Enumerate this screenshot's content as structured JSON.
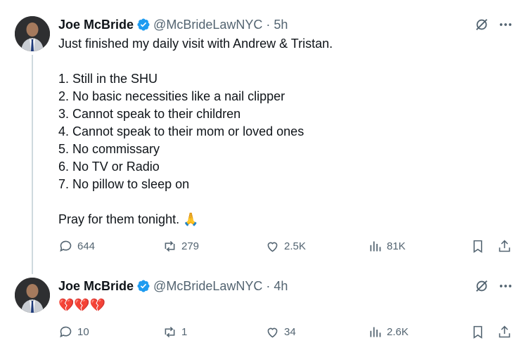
{
  "colors": {
    "verified": "#1d9bf0",
    "secondary_text": "#536471",
    "primary_text": "#0f1419",
    "thread_line": "#cfd9de",
    "heart": "#dd2e44"
  },
  "tweets": [
    {
      "name": "Joe McBride",
      "handle": "@McBrideLawNYC",
      "separator": "·",
      "time": "5h",
      "lines": [
        "Just finished my daily visit with Andrew & Tristan.",
        "",
        "1. Still in the SHU",
        "2. No basic necessities like a nail clipper",
        "3. Cannot speak to their children",
        "4. Cannot speak to their mom or loved ones",
        "5. No commissary",
        "6. No TV or Radio",
        "7. No pillow to sleep on",
        "",
        "Pray for them tonight. 🙏"
      ],
      "replies": "644",
      "reposts": "279",
      "likes": "2.5K",
      "views": "81K"
    },
    {
      "name": "Joe McBride",
      "handle": "@McBrideLawNYC",
      "separator": "·",
      "time": "4h",
      "lines": [
        "💔💔💔"
      ],
      "replies": "10",
      "reposts": "1",
      "likes": "34",
      "views": "2.6K"
    }
  ]
}
